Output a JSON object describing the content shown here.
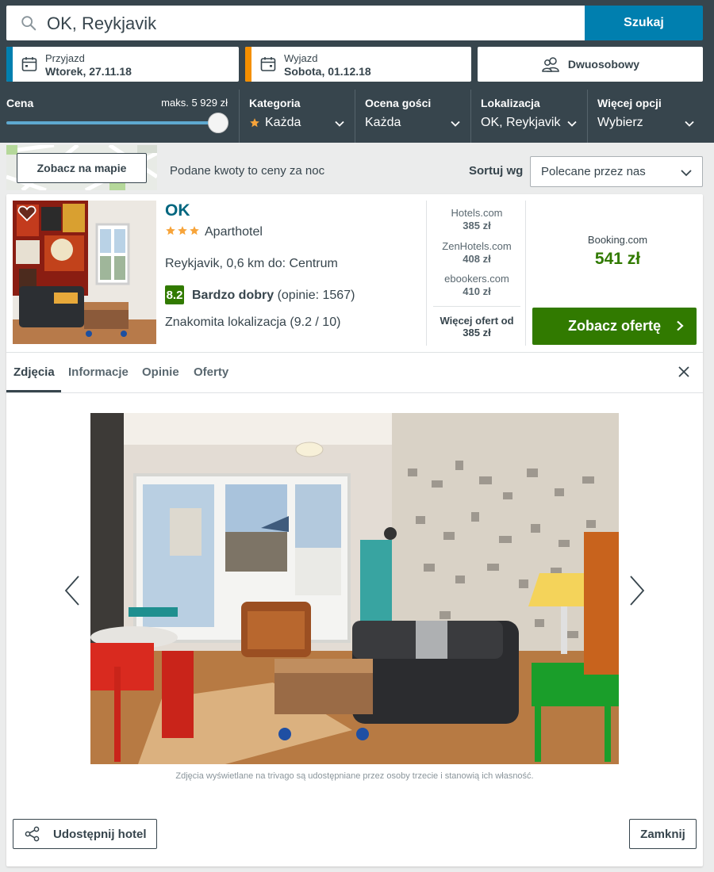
{
  "search": {
    "query": "OK, Reykjavik",
    "button_label": "Szukaj"
  },
  "dates": {
    "checkin_label": "Przyjazd",
    "checkin_value": "Wtorek, 27.11.18",
    "checkout_label": "Wyjazd",
    "checkout_value": "Sobota, 01.12.18"
  },
  "room": {
    "label": "Dwuosobowy"
  },
  "filters": {
    "price_title": "Cena",
    "price_max": "maks. 5 929 zł",
    "price_slider_fraction": 1.0,
    "category_title": "Kategoria",
    "category_value": "Każda",
    "guest_rating_title": "Ocena gości",
    "guest_rating_value": "Każda",
    "location_title": "Lokalizacja",
    "location_value": "OK, Reykjavik",
    "more_title": "Więcej opcji",
    "more_value": "Wybierz"
  },
  "toolbar": {
    "map_button": "Zobacz na mapie",
    "price_note": "Podane kwoty to ceny za noc",
    "sort_label": "Sortuj wg",
    "sort_value": "Polecane przez nas"
  },
  "hotel": {
    "name": "OK",
    "star_count": 3,
    "type": "Aparthotel",
    "location": "Reykjavik, 0,6 km do: Centrum",
    "rating_score": "8.2",
    "rating_label": "Bardzo dobry",
    "rating_reviews": "(opinie: 1567)",
    "highlight": "Znakomita lokalizacja (9.2 / 10)"
  },
  "deals": [
    {
      "provider": "Hotels.com",
      "price": "385 zł"
    },
    {
      "provider": "ZenHotels.com",
      "price": "408 zł"
    },
    {
      "provider": "ebookers.com",
      "price": "410 zł"
    }
  ],
  "more_deals": {
    "label": "Więcej ofert od",
    "price": "385 zł"
  },
  "best_deal": {
    "provider": "Booking.com",
    "price": "541 zł",
    "button_label": "Zobacz ofertę"
  },
  "tabs": [
    {
      "label": "Zdjęcia",
      "active": true
    },
    {
      "label": "Informacje",
      "active": false
    },
    {
      "label": "Opinie",
      "active": false
    },
    {
      "label": "Oferty",
      "active": false
    }
  ],
  "gallery": {
    "credit": "Zdjęcia wyświetlane na trivago są udostępniane przez osoby trzecie i stanowią ich własność."
  },
  "footer": {
    "share_label": "Udostępnij hotel",
    "close_label": "Zamknij"
  },
  "colors": {
    "header_bg": "#37454d",
    "primary_blue": "#007faf",
    "deal_green": "#317a00",
    "checkout_orange": "#f48f00",
    "link_teal": "#00667f"
  }
}
